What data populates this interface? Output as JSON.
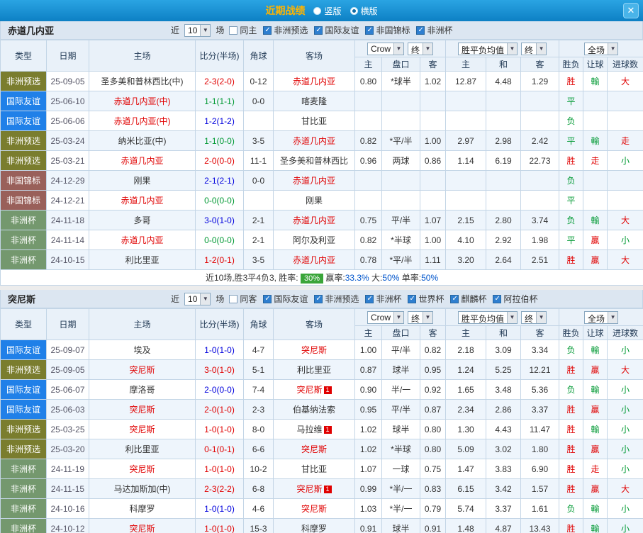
{
  "titlebar": {
    "title": "近期战绩",
    "radios": [
      {
        "label": "竖版",
        "selected": false
      },
      {
        "label": "横版",
        "selected": true
      }
    ],
    "close_label": "✕"
  },
  "controls": {
    "book": "Crow",
    "final": "终",
    "avg": "胜平负均值",
    "scope": "全场"
  },
  "columns": [
    "类型",
    "日期",
    "主场",
    "比分(半场)",
    "角球",
    "客场",
    "主",
    "盘口",
    "客",
    "主",
    "和",
    "客",
    "胜负",
    "让球",
    "进球数"
  ],
  "type_colors": {
    "非洲预选": "#7a7d2e",
    "国际友谊": "#2080e8",
    "非国锦标": "#99605a",
    "非洲杯": "#74986e"
  },
  "sections": [
    {
      "team": "赤道几内亚",
      "filter": {
        "near_label": "近",
        "count": "10",
        "games_label": "场",
        "checkboxes": [
          {
            "label": "同主",
            "checked": false
          },
          {
            "label": "非洲预选",
            "checked": true
          },
          {
            "label": "国际友谊",
            "checked": true
          },
          {
            "label": "非国锦标",
            "checked": true
          },
          {
            "label": "非洲杯",
            "checked": true
          }
        ]
      },
      "rows": [
        {
          "type": "非洲预选",
          "date": "25-09-05",
          "home": "圣多美和普林西比(中)",
          "score": "2-3(2-0)",
          "score_cls": "w",
          "corner": "0-12",
          "away": "赤道几内亚",
          "away_self": true,
          "odds": [
            "0.80",
            "*球半",
            "1.02"
          ],
          "avg": [
            "12.87",
            "4.48",
            "1.29"
          ],
          "res": [
            [
              "胜",
              "r"
            ],
            [
              "輸",
              "g"
            ],
            [
              "大",
              "r"
            ]
          ]
        },
        {
          "type": "国际友谊",
          "date": "25-06-10",
          "home": "赤道几内亚(中)",
          "home_self": true,
          "score": "1-1(1-1)",
          "score_cls": "d",
          "corner": "0-0",
          "away": "喀麦隆",
          "odds": [
            "",
            "",
            ""
          ],
          "avg": [
            "",
            "",
            ""
          ],
          "res": [
            [
              "平",
              "g"
            ],
            [
              "",
              ""
            ],
            [
              "",
              ""
            ]
          ]
        },
        {
          "type": "国际友谊",
          "date": "25-06-06",
          "home": "赤道几内亚(中)",
          "home_self": true,
          "score": "1-2(1-2)",
          "score_cls": "l",
          "corner": "",
          "away": "甘比亚",
          "odds": [
            "",
            "",
            ""
          ],
          "avg": [
            "",
            "",
            ""
          ],
          "res": [
            [
              "负",
              "g"
            ],
            [
              "",
              ""
            ],
            [
              "",
              ""
            ]
          ]
        },
        {
          "type": "非洲预选",
          "date": "25-03-24",
          "home": "纳米比亚(中)",
          "score": "1-1(0-0)",
          "score_cls": "d",
          "corner": "3-5",
          "away": "赤道几内亚",
          "away_self": true,
          "odds": [
            "0.82",
            "*平/半",
            "1.00"
          ],
          "avg": [
            "2.97",
            "2.98",
            "2.42"
          ],
          "res": [
            [
              "平",
              "g"
            ],
            [
              "輸",
              "g"
            ],
            [
              "走",
              "r"
            ]
          ]
        },
        {
          "type": "非洲预选",
          "date": "25-03-21",
          "home": "赤道几内亚",
          "home_self": true,
          "score": "2-0(0-0)",
          "score_cls": "w",
          "corner": "11-1",
          "away": "圣多美和普林西比",
          "odds": [
            "0.96",
            "两球",
            "0.86"
          ],
          "avg": [
            "1.14",
            "6.19",
            "22.73"
          ],
          "res": [
            [
              "胜",
              "r"
            ],
            [
              "走",
              "r"
            ],
            [
              "小",
              "g"
            ]
          ]
        },
        {
          "type": "非国锦标",
          "date": "24-12-29",
          "home": "刚果",
          "score": "2-1(2-1)",
          "score_cls": "l",
          "corner": "0-0",
          "away": "赤道几内亚",
          "away_self": true,
          "odds": [
            "",
            "",
            ""
          ],
          "avg": [
            "",
            "",
            ""
          ],
          "res": [
            [
              "负",
              "g"
            ],
            [
              "",
              ""
            ],
            [
              "",
              ""
            ]
          ]
        },
        {
          "type": "非国锦标",
          "date": "24-12-21",
          "home": "赤道几内亚",
          "home_self": true,
          "score": "0-0(0-0)",
          "score_cls": "d",
          "corner": "",
          "away": "刚果",
          "odds": [
            "",
            "",
            ""
          ],
          "avg": [
            "",
            "",
            ""
          ],
          "res": [
            [
              "平",
              "g"
            ],
            [
              "",
              ""
            ],
            [
              "",
              ""
            ]
          ]
        },
        {
          "type": "非洲杯",
          "date": "24-11-18",
          "home": "多哥",
          "score": "3-0(1-0)",
          "score_cls": "l",
          "corner": "2-1",
          "away": "赤道几内亚",
          "away_self": true,
          "odds": [
            "0.75",
            "平/半",
            "1.07"
          ],
          "avg": [
            "2.15",
            "2.80",
            "3.74"
          ],
          "res": [
            [
              "负",
              "g"
            ],
            [
              "輸",
              "g"
            ],
            [
              "大",
              "r"
            ]
          ]
        },
        {
          "type": "非洲杯",
          "date": "24-11-14",
          "home": "赤道几内亚",
          "home_self": true,
          "score": "0-0(0-0)",
          "score_cls": "d",
          "corner": "2-1",
          "away": "阿尔及利亚",
          "odds": [
            "0.82",
            "*半球",
            "1.00"
          ],
          "avg": [
            "4.10",
            "2.92",
            "1.98"
          ],
          "res": [
            [
              "平",
              "g"
            ],
            [
              "贏",
              "r"
            ],
            [
              "小",
              "g"
            ]
          ]
        },
        {
          "type": "非洲杯",
          "date": "24-10-15",
          "home": "利比里亚",
          "score": "1-2(0-1)",
          "score_cls": "w",
          "corner": "3-5",
          "away": "赤道几内亚",
          "away_self": true,
          "odds": [
            "0.78",
            "*平/半",
            "1.11"
          ],
          "avg": [
            "3.20",
            "2.64",
            "2.51"
          ],
          "res": [
            [
              "胜",
              "r"
            ],
            [
              "贏",
              "r"
            ],
            [
              "大",
              "r"
            ]
          ]
        }
      ],
      "summary": {
        "text": "近10场,胜3平4负3,",
        "rate_label": "胜率:",
        "rate_badge": "30%",
        "parts": [
          {
            "label": "赢率:",
            "value": "33.3%"
          },
          {
            "label": "大:",
            "value": "50%"
          },
          {
            "label": "单率:",
            "value": "50%"
          }
        ]
      }
    },
    {
      "team": "突尼斯",
      "filter": {
        "near_label": "近",
        "count": "10",
        "games_label": "场",
        "checkboxes": [
          {
            "label": "同客",
            "checked": false
          },
          {
            "label": "国际友谊",
            "checked": true
          },
          {
            "label": "非洲预选",
            "checked": true
          },
          {
            "label": "非洲杯",
            "checked": true
          },
          {
            "label": "世界杯",
            "checked": true
          },
          {
            "label": "麒麟杯",
            "checked": true
          },
          {
            "label": "阿拉伯杯",
            "checked": true
          }
        ]
      },
      "rows": [
        {
          "type": "国际友谊",
          "date": "25-09-07",
          "home": "埃及",
          "score": "1-0(1-0)",
          "score_cls": "l",
          "corner": "4-7",
          "away": "突尼斯",
          "away_self": true,
          "odds": [
            "1.00",
            "平/半",
            "0.82"
          ],
          "avg": [
            "2.18",
            "3.09",
            "3.34"
          ],
          "res": [
            [
              "负",
              "g"
            ],
            [
              "輸",
              "g"
            ],
            [
              "小",
              "g"
            ]
          ]
        },
        {
          "type": "非洲预选",
          "date": "25-09-05",
          "home": "突尼斯",
          "home_self": true,
          "score": "3-0(1-0)",
          "score_cls": "w",
          "corner": "5-1",
          "away": "利比里亚",
          "odds": [
            "0.87",
            "球半",
            "0.95"
          ],
          "avg": [
            "1.24",
            "5.25",
            "12.21"
          ],
          "res": [
            [
              "胜",
              "r"
            ],
            [
              "贏",
              "r"
            ],
            [
              "大",
              "r"
            ]
          ]
        },
        {
          "type": "国际友谊",
          "date": "25-06-07",
          "home": "摩洛哥",
          "score": "2-0(0-0)",
          "score_cls": "l",
          "corner": "7-4",
          "away": "突尼斯",
          "away_self": true,
          "away_badge": "1",
          "odds": [
            "0.90",
            "半/一",
            "0.92"
          ],
          "avg": [
            "1.65",
            "3.48",
            "5.36"
          ],
          "res": [
            [
              "负",
              "g"
            ],
            [
              "輸",
              "g"
            ],
            [
              "小",
              "g"
            ]
          ]
        },
        {
          "type": "国际友谊",
          "date": "25-06-03",
          "home": "突尼斯",
          "home_self": true,
          "score": "2-0(1-0)",
          "score_cls": "w",
          "corner": "2-3",
          "away": "伯基纳法索",
          "odds": [
            "0.95",
            "平/半",
            "0.87"
          ],
          "avg": [
            "2.34",
            "2.86",
            "3.37"
          ],
          "res": [
            [
              "胜",
              "r"
            ],
            [
              "贏",
              "r"
            ],
            [
              "小",
              "g"
            ]
          ]
        },
        {
          "type": "非洲预选",
          "date": "25-03-25",
          "home": "突尼斯",
          "home_self": true,
          "score": "1-0(1-0)",
          "score_cls": "w",
          "corner": "8-0",
          "away": "马拉维",
          "away_badge": "1",
          "odds": [
            "1.02",
            "球半",
            "0.80"
          ],
          "avg": [
            "1.30",
            "4.43",
            "11.47"
          ],
          "res": [
            [
              "胜",
              "r"
            ],
            [
              "輸",
              "g"
            ],
            [
              "小",
              "g"
            ]
          ]
        },
        {
          "type": "非洲预选",
          "date": "25-03-20",
          "home": "利比里亚",
          "score": "0-1(0-1)",
          "score_cls": "w",
          "corner": "6-6",
          "away": "突尼斯",
          "away_self": true,
          "odds": [
            "1.02",
            "*半球",
            "0.80"
          ],
          "avg": [
            "5.09",
            "3.02",
            "1.80"
          ],
          "res": [
            [
              "胜",
              "r"
            ],
            [
              "贏",
              "r"
            ],
            [
              "小",
              "g"
            ]
          ]
        },
        {
          "type": "非洲杯",
          "date": "24-11-19",
          "home": "突尼斯",
          "home_self": true,
          "score": "1-0(1-0)",
          "score_cls": "w",
          "corner": "10-2",
          "away": "甘比亚",
          "odds": [
            "1.07",
            "一球",
            "0.75"
          ],
          "avg": [
            "1.47",
            "3.83",
            "6.90"
          ],
          "res": [
            [
              "胜",
              "r"
            ],
            [
              "走",
              "r"
            ],
            [
              "小",
              "g"
            ]
          ]
        },
        {
          "type": "非洲杯",
          "date": "24-11-15",
          "home": "马达加斯加(中)",
          "score": "2-3(2-2)",
          "score_cls": "w",
          "corner": "6-8",
          "away": "突尼斯",
          "away_self": true,
          "away_badge": "1",
          "odds": [
            "0.99",
            "*半/一",
            "0.83"
          ],
          "avg": [
            "6.15",
            "3.42",
            "1.57"
          ],
          "res": [
            [
              "胜",
              "r"
            ],
            [
              "贏",
              "r"
            ],
            [
              "大",
              "r"
            ]
          ]
        },
        {
          "type": "非洲杯",
          "date": "24-10-16",
          "home": "科摩罗",
          "score": "1-0(1-0)",
          "score_cls": "l",
          "corner": "4-6",
          "away": "突尼斯",
          "away_self": true,
          "odds": [
            "1.03",
            "*半/一",
            "0.79"
          ],
          "avg": [
            "5.74",
            "3.37",
            "1.61"
          ],
          "res": [
            [
              "负",
              "g"
            ],
            [
              "輸",
              "g"
            ],
            [
              "小",
              "g"
            ]
          ]
        },
        {
          "type": "非洲杯",
          "date": "24-10-12",
          "home": "突尼斯",
          "home_self": true,
          "score": "1-0(1-0)",
          "score_cls": "w",
          "corner": "15-3",
          "away": "科摩罗",
          "odds": [
            "0.91",
            "球半",
            "0.91"
          ],
          "avg": [
            "1.48",
            "4.87",
            "13.43"
          ],
          "res": [
            [
              "胜",
              "r"
            ],
            [
              "輸",
              "g"
            ],
            [
              "小",
              "g"
            ]
          ]
        }
      ]
    }
  ]
}
